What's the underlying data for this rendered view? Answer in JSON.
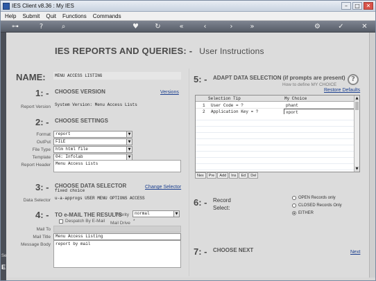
{
  "window": {
    "title": "IES Client v8.36 : My IES",
    "minimize": "–",
    "maximize": "□",
    "close": "✕"
  },
  "menu": [
    "Help",
    "Submit",
    "Quit",
    "Functions",
    "Commands"
  ],
  "toolbar": {
    "icons": [
      "key-icon",
      "help-icon",
      "search-icon",
      "heart-icon",
      "refresh-icon",
      "rewind-icon",
      "back-icon",
      "forward-icon",
      "fast-forward-icon",
      "settings-icon",
      "ok-icon",
      "close-icon"
    ]
  },
  "left_strip": {
    "label_small": "Se",
    "label_big": "E"
  },
  "page": {
    "title": "IES REPORTS AND QUERIES: -",
    "subtitle": "User Instructions"
  },
  "name": {
    "label": "NAME:",
    "value": "MENU ACCESS LISTING"
  },
  "step1": {
    "num": "1: -",
    "title": "CHOOSE VERSION",
    "link": "Versions",
    "version_label": "Report Version",
    "version_value": "System Version: Menu Access Lists"
  },
  "step2": {
    "num": "2: -",
    "title": "CHOOSE SETTINGS",
    "format_label": "Format",
    "format_value": "report",
    "output_label": "OutPut",
    "output_value": "FILE",
    "filetype_label": "File Type",
    "filetype_value": "htm html file",
    "template_label": "Template",
    "template_value": "04: Infolab",
    "header_label": "Report Header",
    "header_value": "Menu Access Lists"
  },
  "step3": {
    "num": "3: -",
    "title": "CHOOSE DATA SELECTOR",
    "link": "Change Selector",
    "line1": "fixed choice",
    "selector_label": "Data Selector",
    "selector_value": "u-a-approgs USER MENU OPTIONS ACCESS"
  },
  "step4": {
    "num": "4: -",
    "title": "TO e-MAIL THE RESULTS",
    "priority_label": "Priority",
    "priority_value": "normal",
    "despatch_label": "Despatch By E-Mail",
    "maildrive_label": "Mail Drive",
    "maildrive_value": "*",
    "mailto_label": "Mail To",
    "mailtitle_label": "Mail Title",
    "mailtitle_value": "Menu Access Listing",
    "mailbody_label": "Message Body",
    "mailbody_value": "report by mail"
  },
  "step5": {
    "num": "5: -",
    "title": "ADAPT DATA SELECTION (if prompts are present)",
    "howto": "How to define MY CHOICE",
    "restore": "Restore Defaults",
    "help": "?",
    "columns": [
      "Selection Tip",
      "My Choice"
    ],
    "rows": [
      {
        "n": "1",
        "tip": "User Code = ?",
        "choice": "phant"
      },
      {
        "n": "2",
        "tip": "Application Key = ?",
        "choice": "xport"
      }
    ],
    "nav": [
      "Nex",
      "Pre",
      "Add",
      "Ins",
      "Ed",
      "Del"
    ]
  },
  "step6": {
    "num": "6: -",
    "title": "Record",
    "subtitle": "Select:",
    "options": [
      "OPEN Records only",
      "CLOSED Records Only",
      "EITHER"
    ],
    "selected": "EITHER"
  },
  "step7": {
    "num": "7: -",
    "title": "CHOOSE NEXT",
    "link": "Next"
  }
}
